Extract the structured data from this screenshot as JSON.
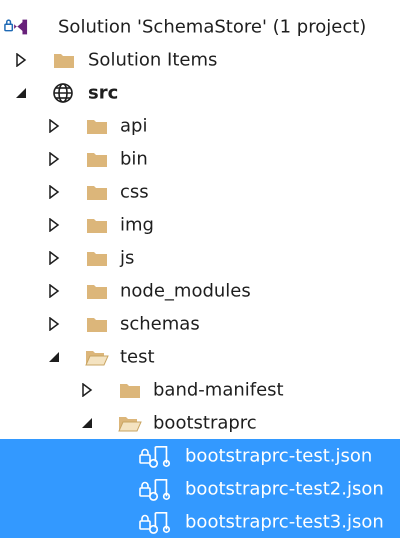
{
  "explorer": {
    "solution": {
      "label": "Solution 'SchemaStore' (1 project)",
      "icon": "visual-studio-solution-icon"
    },
    "items": [
      {
        "label": "Solution Items",
        "icon": "folder-icon",
        "expanded": false
      },
      {
        "label": "src",
        "icon": "globe-icon",
        "expanded": true
      },
      {
        "label": "api",
        "icon": "folder-icon",
        "expanded": false
      },
      {
        "label": "bin",
        "icon": "folder-icon",
        "expanded": false
      },
      {
        "label": "css",
        "icon": "folder-icon",
        "expanded": false
      },
      {
        "label": "img",
        "icon": "folder-icon",
        "expanded": false
      },
      {
        "label": "js",
        "icon": "folder-icon",
        "expanded": false
      },
      {
        "label": "node_modules",
        "icon": "folder-icon",
        "expanded": false
      },
      {
        "label": "schemas",
        "icon": "folder-icon",
        "expanded": false
      },
      {
        "label": "test",
        "icon": "folder-open-icon",
        "expanded": true
      },
      {
        "label": "band-manifest",
        "icon": "folder-icon",
        "expanded": false
      },
      {
        "label": "bootstraprc",
        "icon": "folder-open-icon",
        "expanded": true
      },
      {
        "label": "bootstraprc-test.json",
        "icon": "json-schema-file-icon",
        "selected": true
      },
      {
        "label": "bootstraprc-test2.json",
        "icon": "json-schema-file-icon",
        "selected": true
      },
      {
        "label": "bootstraprc-test3.json",
        "icon": "json-schema-file-icon",
        "selected": true
      }
    ]
  },
  "colors": {
    "selection": "#3399ff",
    "folder": "#dcb67a",
    "text": "#1e1e1e",
    "vs_purple": "#68217a"
  }
}
